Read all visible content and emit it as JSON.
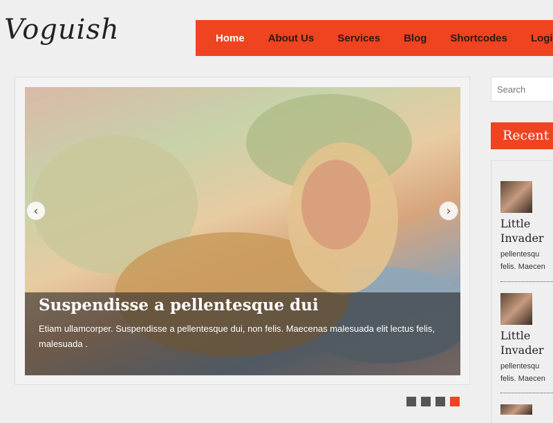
{
  "site": {
    "logo": "Voguish"
  },
  "nav": {
    "items": [
      "Home",
      "About Us",
      "Services",
      "Blog",
      "Shortcodes",
      "Login"
    ],
    "active_index": 0
  },
  "slider": {
    "title": "Suspendisse a pellentesque dui",
    "text": "Etiam ullamcorper. Suspendisse a pellentesque dui, non felis. Maecenas malesuada elit lectus felis, malesuada .",
    "prev_icon": "chevron-left-icon",
    "next_icon": "chevron-right-icon",
    "pager_count": 4,
    "active_slide": 4
  },
  "sidebar": {
    "search_placeholder": "Search",
    "widget_title": "Recent P",
    "posts": [
      {
        "title_line1": "Little",
        "title_line2": "Invader",
        "excerpt_line1": "pellentesqu",
        "excerpt_line2": "felis. Maecen"
      },
      {
        "title_line1": "Little",
        "title_line2": "Invader",
        "excerpt_line1": "pellentesqu",
        "excerpt_line2": "felis. Maecen"
      }
    ]
  },
  "colors": {
    "accent": "#f0431f",
    "background": "#efefef"
  }
}
